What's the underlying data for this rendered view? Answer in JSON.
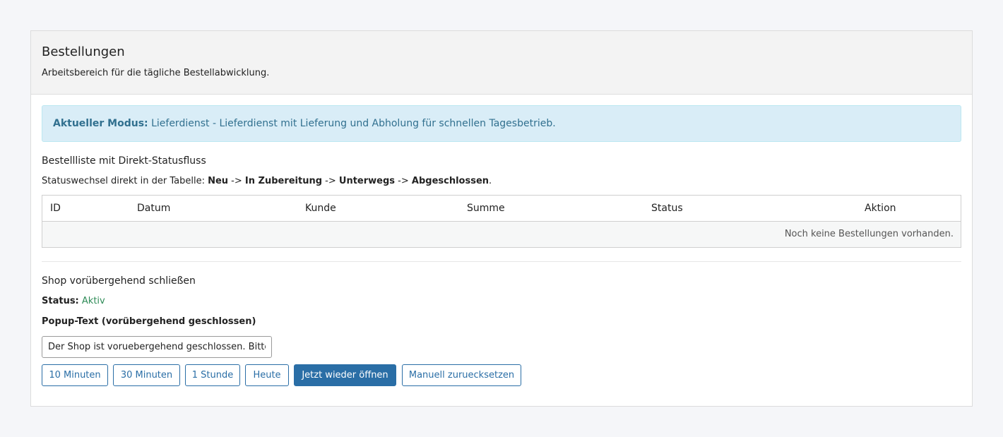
{
  "header": {
    "title": "Bestellungen",
    "subtitle": "Arbeitsbereich für die tägliche Bestellabwicklung."
  },
  "alert": {
    "label": "Aktueller Modus:",
    "text": " Lieferdienst - Lieferdienst mit Lieferung und Abholung für schnellen Tagesbetrieb."
  },
  "orders": {
    "title": "Bestellliste mit Direkt-Statusfluss",
    "flow_prefix": "Statuswechsel direkt in der Tabelle: ",
    "flow_steps": [
      "Neu",
      "In Zubereitung",
      "Unterwegs",
      "Abgeschlossen"
    ],
    "flow_sep": " -> ",
    "flow_end": ".",
    "columns": [
      "ID",
      "Datum",
      "Kunde",
      "Summe",
      "Status",
      "Aktion"
    ],
    "empty_message": "Noch keine Bestellungen vorhanden."
  },
  "shop": {
    "title": "Shop vorübergehend schließen",
    "status_label": "Status:",
    "status_value": " Aktiv",
    "status_color": "#2e8b57",
    "popup_label": "Popup-Text (vorübergehend geschlossen)",
    "popup_value": "Der Shop ist voruebergehend geschlossen. Bitte",
    "buttons": {
      "min10": "10 Minuten",
      "min30": "30 Minuten",
      "hour1": "1 Stunde",
      "today": "Heute",
      "reopen": "Jetzt wieder öffnen",
      "reset": "Manuell zuruecksetzen"
    }
  },
  "colors": {
    "primary": "#2a6ea6",
    "alert_bg": "#d9edf7",
    "alert_text": "#31708f"
  }
}
